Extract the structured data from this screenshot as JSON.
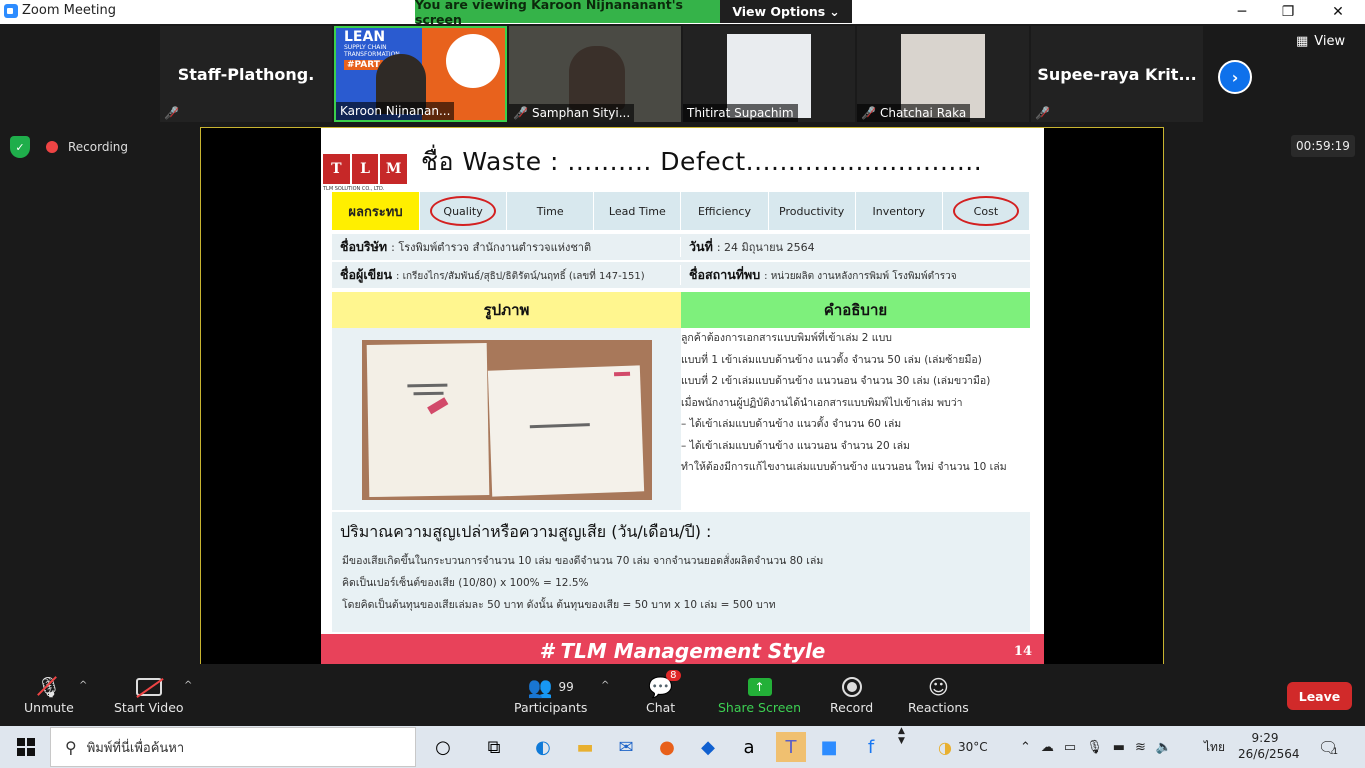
{
  "window": {
    "title": "Zoom Meeting",
    "minimize": "─",
    "maximize": "❐",
    "close": "✕"
  },
  "banner": {
    "message": "You are viewing Karoon Nijnananant's screen",
    "options_label": "View Options",
    "options_caret": "⌄"
  },
  "participants_strip": {
    "tiles": [
      {
        "name": "Staff-Plathong.",
        "muted": true,
        "video": false
      },
      {
        "name": "Karoon Nijnanan...",
        "muted": false,
        "video": true,
        "active_speaker": true
      },
      {
        "name": "Samphan Sityi...",
        "muted": true,
        "video": true
      },
      {
        "name": "Thitirat Supachim",
        "muted": false,
        "video": true
      },
      {
        "name": "Chatchai Raka",
        "muted": true,
        "video": true
      },
      {
        "name": "Supee-raya  Krit...",
        "muted": true,
        "video": false
      }
    ],
    "tile_overlay": {
      "title": "LEAN",
      "subtitle": "SUPPLY CHAIN TRANSFORMATION",
      "part": "#PART"
    },
    "next_icon": "›",
    "view_label": "View"
  },
  "recording": {
    "label": "Recording"
  },
  "timer": "00:59:19",
  "slide": {
    "logo_letters": [
      "T",
      "L",
      "M"
    ],
    "logo_sub": "TLM SOLUTION CO., LTD.",
    "title": "ชื่อ Waste : .......... Defect............................",
    "impact_label": "ผลกระทบ",
    "impacts": [
      "Quality",
      "Time",
      "Lead Time",
      "Efficiency",
      "Productivity",
      "Inventory",
      "Cost"
    ],
    "circled": [
      "Quality",
      "Cost"
    ],
    "company_label": "ชื่อบริษัท",
    "company_value": ": โรงพิมพ์ตำรวจ สำนักงานตำรวจแห่งชาติ",
    "date_label": "วันที่",
    "date_value": ": 24 มิถุนายน 2564",
    "author_label": "ชื่อผู้เขียน",
    "author_value": ": เกรียงไกร/สัมพันธ์/สุธิป/ธิติรัตน์/นฤทธิ์ (เลขที่ 147-151)",
    "location_label": "ชื่อสถานที่พบ",
    "location_value": ": หน่วยผลิต งานหลังการพิมพ์ โรงพิมพ์ตำรวจ",
    "picture_header": "รูปภาพ",
    "desc_header": "คำอธิบาย",
    "desc_lines": [
      "    ลูกค้าต้องการเอกสารแบบพิมพ์ที่เข้าเล่ม 2 แบบ",
      "แบบที่ 1 เข้าเล่มแบบด้านข้าง แนวตั้ง จำนวน 50 เล่ม (เล่มซ้ายมือ)",
      "แบบที่ 2 เข้าเล่มแบบด้านข้าง แนวนอน จำนวน 30 เล่ม (เล่มขวามือ)",
      "    เมื่อพนักงานผู้ปฏิบัติงานได้นำเอกสารแบบพิมพ์ไปเข้าเล่ม พบว่า",
      "–  ได้เข้าเล่มแบบด้านข้าง แนวตั้ง จำนวน 60 เล่ม",
      "–  ได้เข้าเล่มแบบด้านข้าง แนวนอน จำนวน 20 เล่ม",
      "    ทำให้ต้องมีการแก้ไขงานเล่มแบบด้านข้าง แนวนอน ใหม่ จำนวน 10 เล่ม"
    ],
    "loss_title": "ปริมาณความสูญเปล่าหรือความสูญเสีย (วัน/เดือน/ปี) :",
    "loss_lines": [
      "มีของเสียเกิดขึ้นในกระบวนการจำนวน 10 เล่ม ของดีจำนวน 70 เล่ม จากจำนวนยอดสั่งผลิตจำนวน 80 เล่ม",
      "คิดเป็นเปอร์เซ็นต์ของเสีย (10/80) x 100% = 12.5%",
      "โดยคิดเป็นต้นทุนของเสียเล่มละ 50 บาท  ดังนั้น ต้นทุนของเสีย = 50 บาท x 10 เล่ม = 500 บาท"
    ],
    "footer": "# TLM Management Style",
    "page_number": "14"
  },
  "toolbar": {
    "unmute": "Unmute",
    "start_video": "Start Video",
    "participants": "Participants",
    "participants_count": "99",
    "chat": "Chat",
    "chat_badge": "8",
    "share_screen": "Share Screen",
    "record": "Record",
    "reactions": "Reactions",
    "leave": "Leave",
    "caret": "^"
  },
  "taskbar": {
    "search_placeholder": "พิมพ์ที่นี่เพื่อค้นหา",
    "weather": "30°C",
    "language": "ไทย",
    "time": "9:29",
    "date": "26/6/2564",
    "notif_count": "1"
  },
  "colors": {
    "zoom_blue": "#2D8CFF",
    "banner_green": "#35b349",
    "leave_red": "#d12a2a",
    "slide_footer": "#e8425a",
    "impact_yellow": "#ffef00",
    "desc_green": "#7ef07c",
    "picture_yellow": "#fff68f"
  }
}
